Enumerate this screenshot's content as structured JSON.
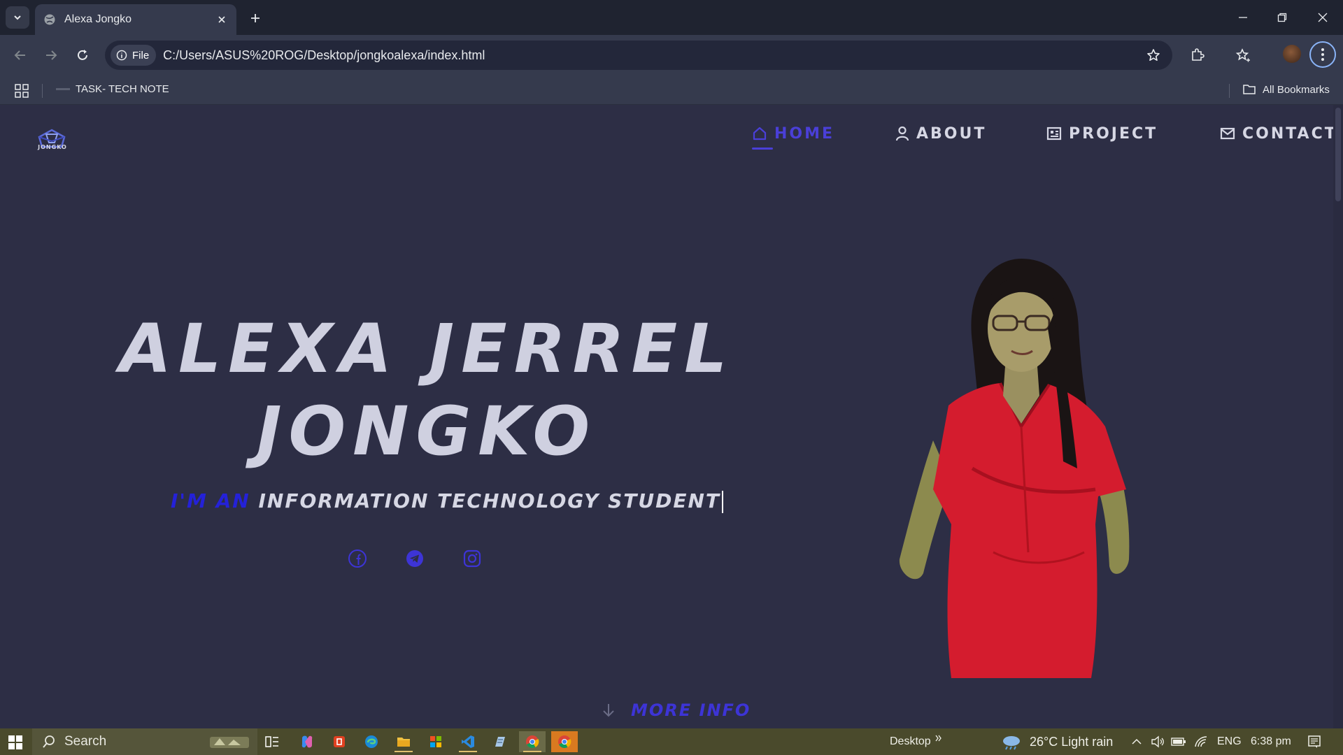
{
  "browser": {
    "tab_title": "Alexa Jongko",
    "address_chip": "File",
    "url": "C:/Users/ASUS%20ROG/Desktop/jongkoalexa/index.html",
    "bookmarks": [
      {
        "label": "TASK- TECH NOTE"
      }
    ],
    "all_bookmarks_label": "All Bookmarks"
  },
  "site": {
    "logo_text": "JONGKO",
    "nav": [
      {
        "label": "HOME",
        "icon": "home-icon",
        "active": true
      },
      {
        "label": "ABOUT",
        "icon": "user-icon",
        "active": false
      },
      {
        "label": "PROJECT",
        "icon": "project-icon",
        "active": false
      },
      {
        "label": "CONTACT",
        "icon": "mail-icon",
        "active": false
      }
    ],
    "hero": {
      "name_line1": "ALEXA JERREL",
      "name_line2": "JONGKO",
      "subtitle_accent": "I'M AN",
      "subtitle_rest": "INFORMATION TECHNOLOGY STUDENT"
    },
    "social": [
      "facebook-icon",
      "telegram-icon",
      "instagram-icon"
    ],
    "more_info": "MORE INFO",
    "colors": {
      "accent": "#4a3fd8",
      "accent_dark": "#2421d8",
      "page_bg": "#2d2e45",
      "text": "#cfd0e0"
    }
  },
  "taskbar": {
    "search_label": "Search",
    "desktop_label": "Desktop",
    "weather": "26°C  Light rain",
    "language": "ENG",
    "time": "6:38 pm"
  }
}
